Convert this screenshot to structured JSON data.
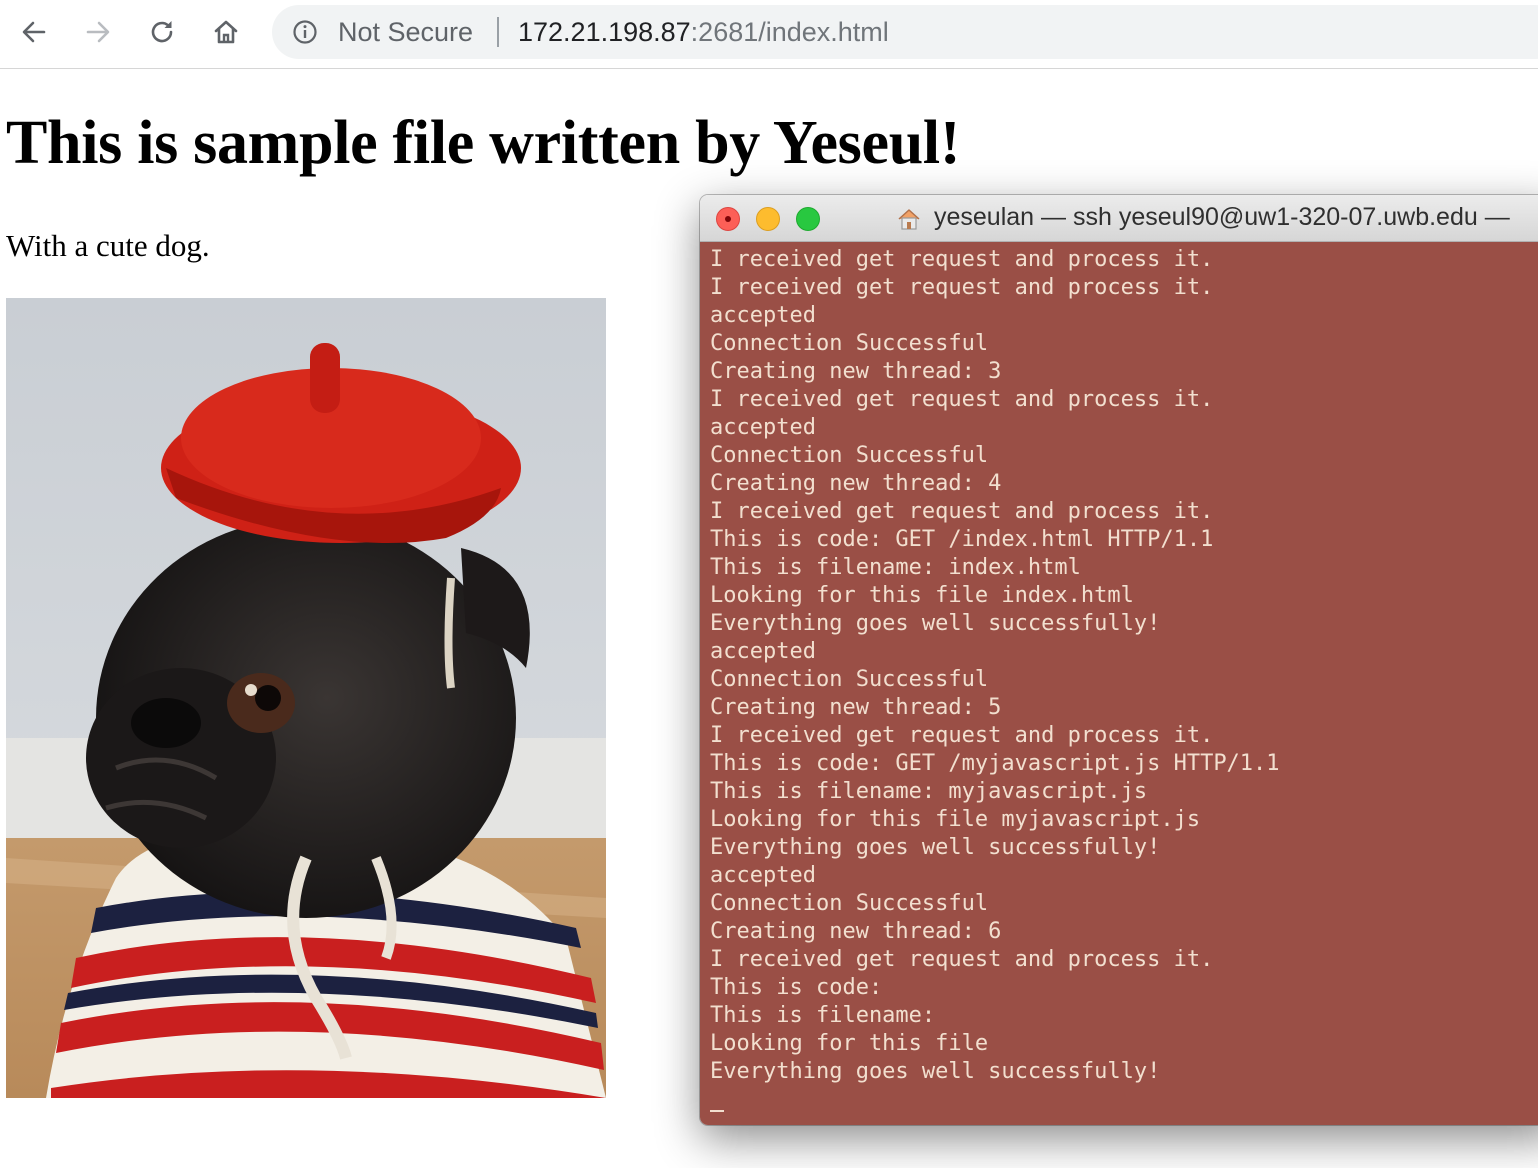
{
  "browser": {
    "security_label": "Not Secure",
    "url_host": "172.21.198.87",
    "url_path": ":2681/index.html",
    "icons": [
      "back-arrow-icon",
      "forward-arrow-icon",
      "reload-icon",
      "home-icon",
      "info-icon"
    ]
  },
  "page": {
    "heading": "This is sample file written by Yeseul!",
    "text": "With a cute dog.",
    "image_subject": "black pug wearing a red beret and striped sweater"
  },
  "terminal": {
    "title": "yeseulan — ssh yeseul90@uw1-320-07.uwb.edu —",
    "background_color": "#9a4f46",
    "text_color": "#f2dfcf",
    "lines": [
      "I received get request and process it.",
      "I received get request and process it.",
      "accepted",
      "Connection Successful",
      "Creating new thread: 3",
      "I received get request and process it.",
      "accepted",
      "Connection Successful",
      "Creating new thread: 4",
      "I received get request and process it.",
      "This is code: GET /index.html HTTP/1.1",
      "This is filename: index.html",
      "Looking for this file index.html",
      "Everything goes well successfully!",
      "accepted",
      "Connection Successful",
      "Creating new thread: 5",
      "I received get request and process it.",
      "This is code: GET /myjavascript.js HTTP/1.1",
      "This is filename: myjavascript.js",
      "Looking for this file myjavascript.js",
      "Everything goes well successfully!",
      "accepted",
      "Connection Successful",
      "Creating new thread: 6",
      "I received get request and process it.",
      "This is code:",
      "This is filename:",
      "Looking for this file",
      "Everything goes well successfully!"
    ]
  }
}
